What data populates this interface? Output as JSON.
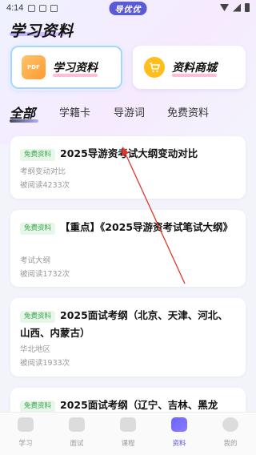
{
  "status_bar": {
    "time": "4:14",
    "brand_pill": "导优优"
  },
  "page": {
    "title": "学习资料"
  },
  "big_cards": [
    {
      "label": "学习资料",
      "icon": "pdf-icon",
      "icon_text": "PDF"
    },
    {
      "label": "资料商城",
      "icon": "cart-icon"
    }
  ],
  "tabs": [
    {
      "label": "全部"
    },
    {
      "label": "学籍卡"
    },
    {
      "label": "导游词"
    },
    {
      "label": "免费资料"
    }
  ],
  "materials": [
    {
      "badge": "免费资料",
      "title": "2025导游资考试大纲变动对比",
      "subtitle": "考纲变动对比",
      "reads": "被阅读4233次"
    },
    {
      "badge": "免费资料",
      "title": "【重点】《2025导游资考试笔试大纲》",
      "subtitle": "考试大纲",
      "reads": "被阅读1732次"
    },
    {
      "badge": "免费资料",
      "title": "2025面试考纲（北京、天津、河北、山西、内蒙古）",
      "subtitle": "华北地区",
      "reads": "被阅读1933次"
    },
    {
      "badge": "免费资料",
      "title": "2025面试考纲（辽宁、吉林、黑龙"
    }
  ],
  "bottom_nav": [
    {
      "label": "学习",
      "icon": "home-icon"
    },
    {
      "label": "面试",
      "icon": "microphone-icon"
    },
    {
      "label": "课程",
      "icon": "video-icon"
    },
    {
      "label": "资料",
      "icon": "folder-icon"
    },
    {
      "label": "我的",
      "icon": "smile-icon"
    }
  ],
  "colors": {
    "accent": "#5a52e0",
    "free_badge_text": "#3aa34a",
    "annotation_arrow": "#e0362b"
  }
}
